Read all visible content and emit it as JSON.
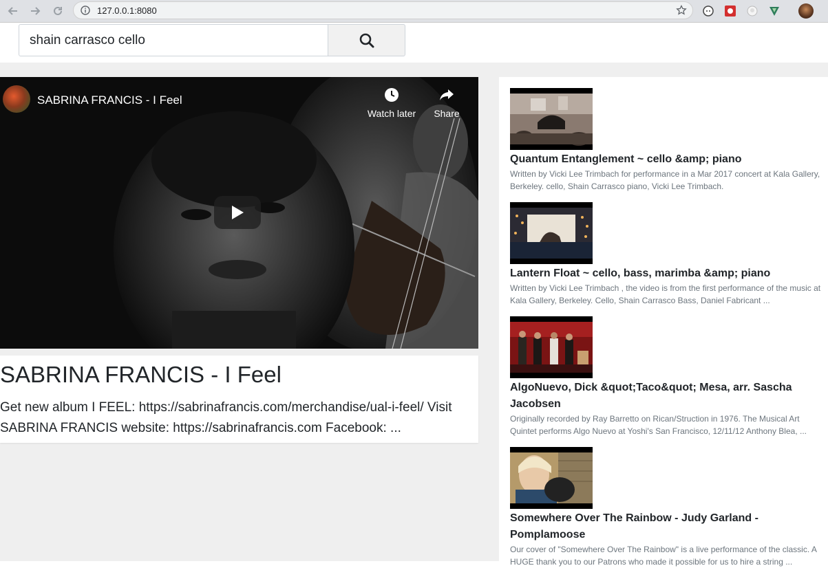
{
  "browser": {
    "url": "127.0.0.1:8080"
  },
  "search": {
    "value": "shain carrasco cello"
  },
  "player": {
    "title": "SABRINA FRANCIS - I Feel",
    "watch_later": "Watch later",
    "share": "Share"
  },
  "main_video": {
    "title": "SABRINA FRANCIS - I Feel",
    "description": "Get new album I FEEL: https://sabrinafrancis.com/merchandise/ual-i-feel/ Visit SABRINA FRANCIS website: https://sabrinafrancis.com Facebook: ..."
  },
  "recommendations": [
    {
      "title": "Quantum Entanglement ~ cello &amp; piano",
      "description": "Written by Vicki Lee Trimbach for performance in a Mar 2017 concert at Kala Gallery, Berkeley. cello, Shain Carrasco piano, Vicki Lee Trimbach."
    },
    {
      "title": "Lantern Float ~ cello, bass, marimba &amp; piano",
      "description": "Written by Vicki Lee Trimbach , the video is from the first performance of the music at Kala Gallery, Berkeley. Cello, Shain Carrasco Bass, Daniel Fabricant ..."
    },
    {
      "title": "AlgoNuevo, Dick &quot;Taco&quot; Mesa, arr. Sascha Jacobsen",
      "description": "Originally recorded by Ray Barretto on Rican/Struction in 1976. The Musical Art Quintet performs Algo Nuevo at Yoshi's San Francisco, 12/11/12 Anthony Blea, ..."
    },
    {
      "title": "Somewhere Over The Rainbow - Judy Garland - Pomplamoose",
      "description": "Our cover of \"Somewhere Over The Rainbow\" is a live performance of the classic. A HUGE thank you to our Patrons who made it possible for us to hire a string ..."
    }
  ]
}
